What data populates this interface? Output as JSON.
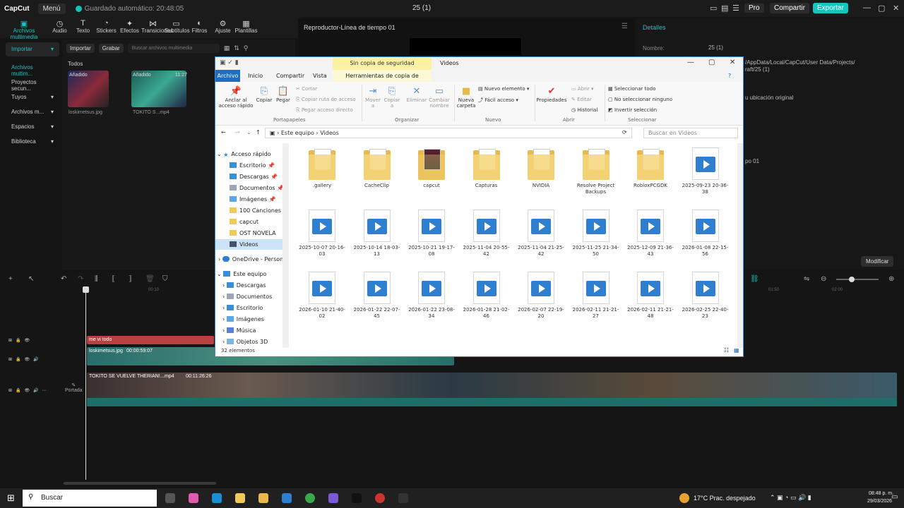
{
  "topbar": {
    "logo": "CapCut",
    "menu": "Menú",
    "autosave": "Guardado automático: 20:48:05",
    "project": "25 (1)",
    "pro": "Pro",
    "share": "Compartir",
    "export": "Exportar",
    "window_controls": [
      "—",
      "▢",
      "✕"
    ]
  },
  "toolbar": [
    {
      "label": "Archivos multimedia",
      "icon": "media-icon"
    },
    {
      "label": "Audio",
      "icon": "audio-icon"
    },
    {
      "label": "Texto",
      "icon": "text-icon"
    },
    {
      "label": "Stickers",
      "icon": "sticker-icon"
    },
    {
      "label": "Efectos",
      "icon": "effects-icon"
    },
    {
      "label": "Transiciones",
      "icon": "transition-icon"
    },
    {
      "label": "Subtítulos",
      "icon": "subtitles-icon"
    },
    {
      "label": "Filtros",
      "icon": "filter-icon"
    },
    {
      "label": "Ajuste",
      "icon": "adjust-icon"
    },
    {
      "label": "Plantillas",
      "icon": "template-icon"
    }
  ],
  "sidebar": [
    {
      "label": "Importar"
    },
    {
      "label": "Archivos multim..."
    },
    {
      "label": "Proyectos secun..."
    },
    {
      "label": "Tuyos"
    },
    {
      "label": "Archivos m..."
    },
    {
      "label": "Espacios"
    },
    {
      "label": "Biblioteca"
    }
  ],
  "media": {
    "import": "Importar",
    "record": "Grabar",
    "search_placeholder": "Buscar archivos multimedia",
    "all": "Todos",
    "items": [
      {
        "added": "Añadido",
        "name": "loskimetsus.jpg",
        "duration": ""
      },
      {
        "added": "Añadido",
        "name": "TOKITO S...mp4",
        "duration": "11:27"
      }
    ]
  },
  "player": {
    "title": "Reproductor-Línea de tiempo 01"
  },
  "details": {
    "title": "Detalles",
    "name_label": "Nombre:",
    "name_value": "25 (1)",
    "path1": "/AppData/Local/CapCut/User Data/Projects/",
    "path2": "raft/25 (1)",
    "original": "u ubicación original",
    "timeline": "po 01",
    "modify": "Modificar"
  },
  "timeline": {
    "track_text": "me vi todo",
    "clip1_name": "loskimetsus.jpg",
    "clip1_dur": "00:00:59:07",
    "clip2_name": "TOKITO SE VUELVE THERIAN!...",
    "clip2_ext": ".mp4",
    "clip2_dur": "00:11:26:26",
    "cover": "Portada",
    "tick1": "00:10",
    "tick2": "01:50",
    "tick3": "02:00"
  },
  "explorer": {
    "ctx_tab": "Sin copia de seguridad",
    "window_title": "Videos",
    "tabs": [
      "Archivo",
      "Inicio",
      "Compartir",
      "Vista",
      "Herramientas de copia de seguridad"
    ],
    "ribbon": {
      "pin": "Anclar al acceso rápido",
      "copy": "Copiar",
      "paste": "Pegar",
      "cut": "Cortar",
      "copy_path": "Copiar ruta de acceso",
      "paste_shortcut": "Pegar acceso directo",
      "clipboard": "Portapapeles",
      "move": "Mover a",
      "copy_to": "Copiar a",
      "delete": "Eliminar",
      "rename": "Cambiar nombre",
      "organize": "Organizar",
      "new_folder": "Nueva carpeta",
      "new_item": "Nuevo elemento",
      "easy_access": "Fácil acceso",
      "new": "Nuevo",
      "properties": "Propiedades",
      "open": "Abrir",
      "edit": "Editar",
      "history": "Historial",
      "open_grp": "Abrir",
      "select_all": "Seleccionar todo",
      "select_none": "No seleccionar ninguno",
      "invert": "Invertir selección",
      "select": "Seleccionar"
    },
    "address": [
      "Este equipo",
      "Videos"
    ],
    "search_placeholder": "Buscar en Videos",
    "nav": [
      {
        "label": "Acceso rápido",
        "icon": "star-icon"
      },
      {
        "label": "Escritorio",
        "icon": "desktop-icon"
      },
      {
        "label": "Descargas",
        "icon": "download-icon"
      },
      {
        "label": "Documentos",
        "icon": "documents-icon"
      },
      {
        "label": "Imágenes",
        "icon": "images-icon"
      },
      {
        "label": "100 Canciones S",
        "icon": "folder-icon"
      },
      {
        "label": "capcut",
        "icon": "folder-icon"
      },
      {
        "label": "OST NOVELA",
        "icon": "folder-icon"
      },
      {
        "label": "Videos",
        "icon": "videos-icon"
      },
      {
        "label": "OneDrive - Person",
        "icon": "cloud-icon"
      },
      {
        "label": "Este equipo",
        "icon": "pc-icon"
      },
      {
        "label": "Descargas",
        "icon": "download-icon"
      },
      {
        "label": "Documentos",
        "icon": "documents-icon"
      },
      {
        "label": "Escritorio",
        "icon": "desktop-icon"
      },
      {
        "label": "Imágenes",
        "icon": "images-icon"
      },
      {
        "label": "Música",
        "icon": "music-icon"
      },
      {
        "label": "Objetos 3D",
        "icon": "cube-icon"
      }
    ],
    "files": [
      {
        "name": ".gallery",
        "type": "folder"
      },
      {
        "name": "CacheClip",
        "type": "folder"
      },
      {
        "name": "capcut",
        "type": "folder-img"
      },
      {
        "name": "Capturas",
        "type": "folder"
      },
      {
        "name": "NVIDIA",
        "type": "folder"
      },
      {
        "name": "Resolve Project Backups",
        "type": "folder"
      },
      {
        "name": "RobloxPCGDK",
        "type": "folder"
      },
      {
        "name": "2025-09-23 20-36-38",
        "type": "video"
      },
      {
        "name": "2025-10-07 20-16-03",
        "type": "video"
      },
      {
        "name": "2025-10-14 18-03-13",
        "type": "video"
      },
      {
        "name": "2025-10-21 19-17-08",
        "type": "video"
      },
      {
        "name": "2025-11-04 20-55-42",
        "type": "video"
      },
      {
        "name": "2025-11-04 21-25-42",
        "type": "video"
      },
      {
        "name": "2025-11-25 21-34-50",
        "type": "video"
      },
      {
        "name": "2025-12-09 21-36-43",
        "type": "video"
      },
      {
        "name": "2026-01-08 22-15-56",
        "type": "video"
      },
      {
        "name": "2026-01-10 21-40-02",
        "type": "video"
      },
      {
        "name": "2026-01-22 22-07-45",
        "type": "video"
      },
      {
        "name": "2026-01-22 23-08-34",
        "type": "video"
      },
      {
        "name": "2026-01-28 21-02-46",
        "type": "video"
      },
      {
        "name": "2026-02-07 22-19-20",
        "type": "video"
      },
      {
        "name": "2026-02-11 21-21-27",
        "type": "video"
      },
      {
        "name": "2026-02-11 21-21-48",
        "type": "video"
      },
      {
        "name": "2026-02-25 22-40-23",
        "type": "video"
      }
    ],
    "status": "32 elementos"
  },
  "taskbar": {
    "search": "Buscar",
    "weather": "17°C  Prac. despejado",
    "time": "08:48 p. m.",
    "date": "29/03/2026"
  }
}
